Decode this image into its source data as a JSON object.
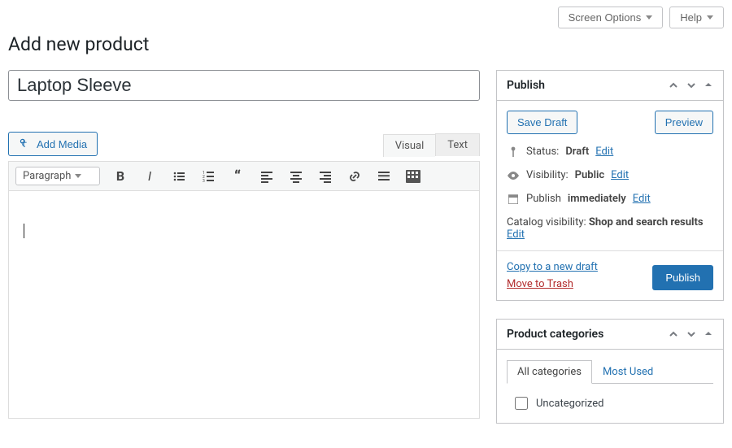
{
  "toolbar": {
    "screen_options": "Screen Options",
    "help": "Help"
  },
  "page_title": "Add new product",
  "product_title": "Laptop Sleeve",
  "media_button": "Add Media",
  "editor_tabs": {
    "visual": "Visual",
    "text": "Text"
  },
  "format_select": "Paragraph",
  "editor_content": "",
  "publish": {
    "heading": "Publish",
    "save_draft": "Save Draft",
    "preview": "Preview",
    "status_label": "Status:",
    "status_value": "Draft",
    "visibility_label": "Visibility:",
    "visibility_value": "Public",
    "publish_label": "Publish",
    "publish_value": "immediately",
    "catalog_label": "Catalog visibility:",
    "catalog_value": "Shop and search results",
    "edit": "Edit",
    "copy_draft": "Copy to a new draft",
    "trash": "Move to Trash",
    "publish_btn": "Publish"
  },
  "categories": {
    "heading": "Product categories",
    "tab_all": "All categories",
    "tab_most": "Most Used",
    "items": [
      "Uncategorized"
    ]
  }
}
